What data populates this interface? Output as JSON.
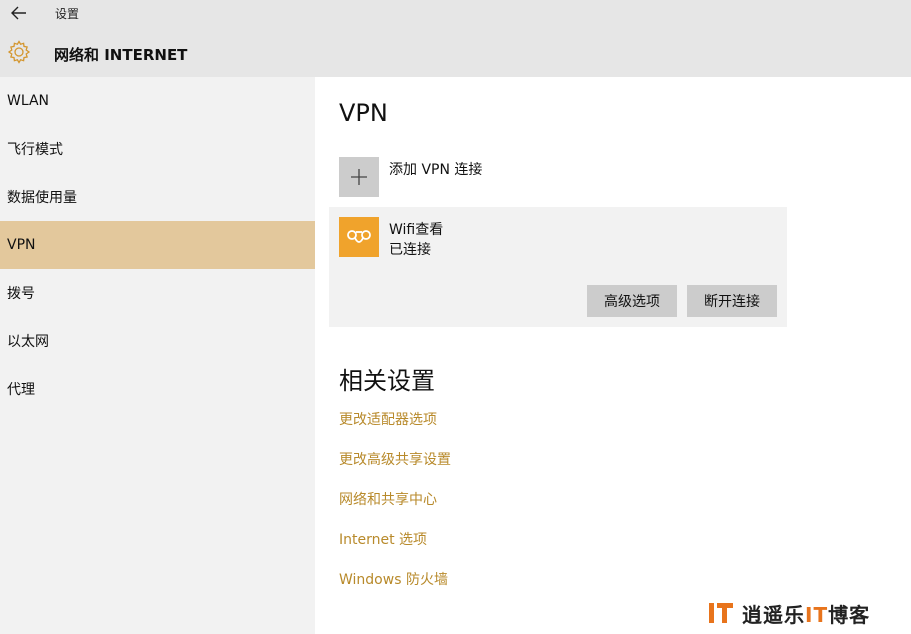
{
  "titlebar": {
    "title": "设置",
    "back_icon": "arrow-left-icon"
  },
  "header": {
    "title": "网络和 INTERNET",
    "icon": "gear-icon"
  },
  "sidebar": {
    "items": [
      {
        "label": "WLAN"
      },
      {
        "label": "飞行模式"
      },
      {
        "label": "数据使用量"
      },
      {
        "label": "VPN",
        "active": true
      },
      {
        "label": "拨号"
      },
      {
        "label": "以太网"
      },
      {
        "label": "代理"
      }
    ]
  },
  "main": {
    "vpn_title": "VPN",
    "add_vpn_label": "添加 VPN 连接",
    "connection": {
      "name": "Wifi查看",
      "status": "已连接",
      "advanced_button": "高级选项",
      "disconnect_button": "断开连接"
    },
    "related_title": "相关设置",
    "related_links": [
      "更改适配器选项",
      "更改高级共享设置",
      "网络和共享中心",
      "Internet 选项",
      "Windows 防火墙"
    ]
  },
  "watermark": {
    "text_main": "逍遥乐",
    "text_accent": "IT",
    "text_end": "博客"
  },
  "colors": {
    "accent": "#f0a32c",
    "active_nav": "#e3c89c",
    "link": "#b88a2b",
    "header_bg": "#e6e6e6",
    "sidebar_bg": "#f2f2f2"
  }
}
